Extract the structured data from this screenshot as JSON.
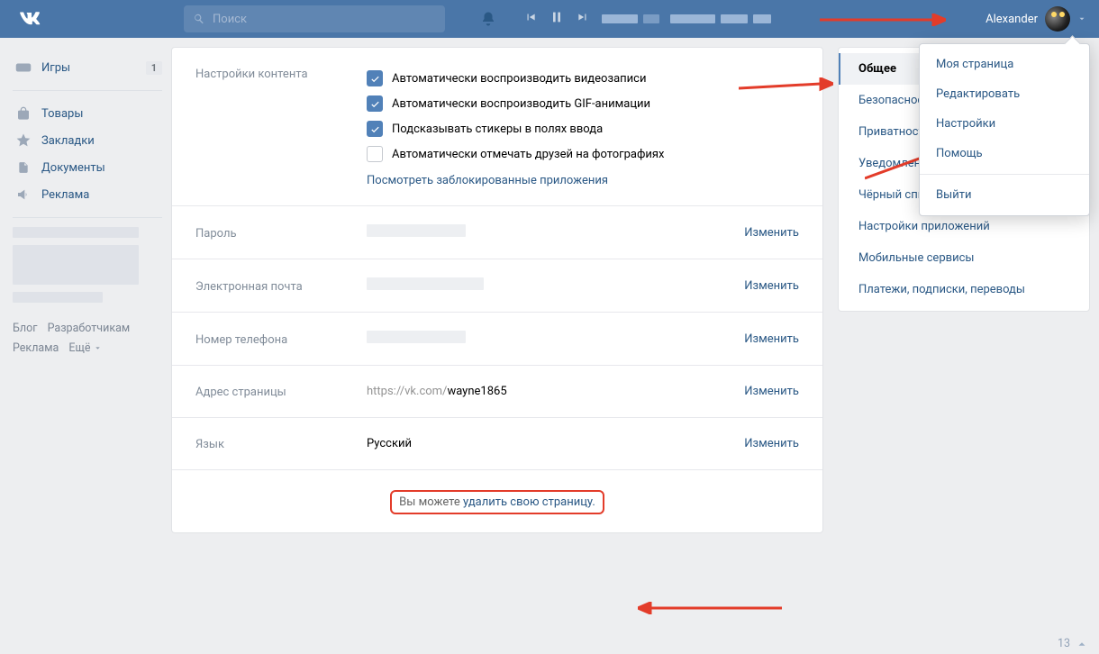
{
  "header": {
    "search_placeholder": "Поиск",
    "user_name": "Alexander"
  },
  "left_nav": {
    "items": [
      {
        "label": "Игры",
        "badge": "1",
        "icon": "gamepad"
      },
      {
        "label": "Товары",
        "badge": null,
        "icon": "bag"
      },
      {
        "label": "Закладки",
        "badge": null,
        "icon": "star"
      },
      {
        "label": "Документы",
        "badge": null,
        "icon": "doc"
      },
      {
        "label": "Реклама",
        "badge": null,
        "icon": "mega"
      }
    ],
    "footer_links": {
      "a": "Блог",
      "b": "Разработчикам",
      "c": "Реклама",
      "d": "Ещё"
    }
  },
  "settings": {
    "content_label": "Настройки контента",
    "checks": [
      {
        "checked": true,
        "label": "Автоматически воспроизводить видеозаписи"
      },
      {
        "checked": true,
        "label": "Автоматически воспроизводить GIF-анимации"
      },
      {
        "checked": true,
        "label": "Подсказывать стикеры в полях ввода"
      },
      {
        "checked": false,
        "label": "Автоматически отмечать друзей на фотографиях"
      }
    ],
    "blocked_apps": "Посмотреть заблокированные приложения",
    "rows": {
      "password": {
        "label": "Пароль",
        "action": "Изменить"
      },
      "email": {
        "label": "Электронная почта",
        "action": "Изменить"
      },
      "phone": {
        "label": "Номер телефона",
        "action": "Изменить"
      },
      "addr": {
        "label": "Адрес страницы",
        "prefix": "https://vk.com/",
        "value": "wayne1865",
        "action": "Изменить"
      },
      "lang": {
        "label": "Язык",
        "value": "Русский",
        "action": "Изменить"
      }
    },
    "delete_prefix": "Вы можете ",
    "delete_link": "удалить свою страницу."
  },
  "right_nav": {
    "tabs": [
      {
        "label": "Общее",
        "active": true
      },
      {
        "label": "Безопасность",
        "active": false
      },
      {
        "label": "Приватность",
        "active": false
      },
      {
        "label": "Уведомления",
        "active": false
      },
      {
        "label": "Чёрный список",
        "active": false
      },
      {
        "label": "Настройки приложений",
        "active": false
      },
      {
        "label": "Мобильные сервисы",
        "active": false
      },
      {
        "label": "Платежи, подписки, переводы",
        "active": false
      }
    ]
  },
  "dropdown": {
    "items": [
      {
        "label": "Моя страница"
      },
      {
        "label": "Редактировать"
      },
      {
        "label": "Настройки"
      },
      {
        "label": "Помощь"
      },
      {
        "sep": true
      },
      {
        "label": "Выйти"
      }
    ]
  },
  "chat_corner": "13"
}
